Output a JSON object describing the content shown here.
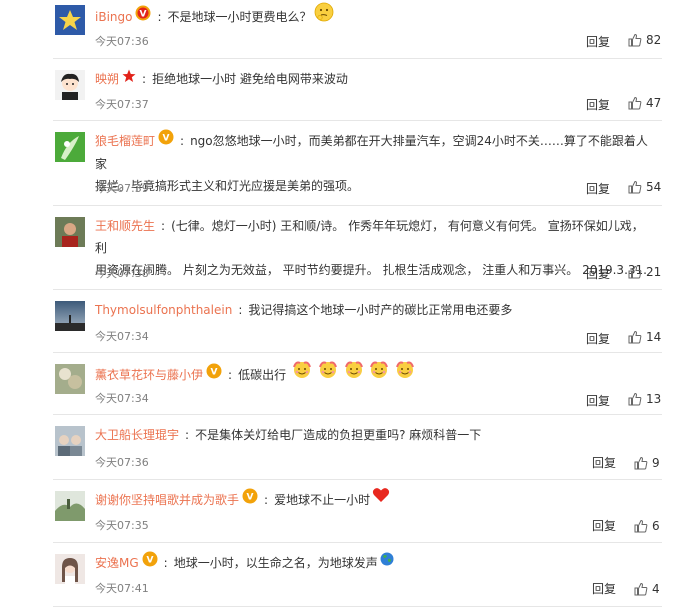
{
  "comments": [
    {
      "user": "iBingo",
      "text": "不是地球一小时更费电么？",
      "time": "今天07:36",
      "reply": "回复",
      "likes": "82"
    },
    {
      "user": "映朔",
      "text": "拒绝地球一小时 避免给电网带来波动",
      "time": "今天07:37",
      "reply": "回复",
      "likes": "47"
    },
    {
      "user": "狼毛榴莲町",
      "text_line1": "ngo忽悠地球一小时，而美弟都在开大排量汽车，空调24小时不关……算了不能跟着人家",
      "text_line2": "摆烂。毕竟搞形式主义和灯光应援是美弟的强项。",
      "time": "今天07:39",
      "reply": "回复",
      "likes": "54"
    },
    {
      "user": "王和顺先生",
      "text_line1": "(七律。熄灯一小时) 王和顺/诗。 作秀年年玩熄灯， 有何意义有何凭。 宣扬环保如儿戏， 利",
      "text_line2": "用资源在闹腾。 片刻之为无效益， 平时节约要提升。 扎根生活成观念， 注重人和万事兴。 2019.3.31.",
      "time": "今天07:38",
      "reply": "回复",
      "likes": "21"
    },
    {
      "user": "Thymolsulfonphthalein",
      "text": "我记得搞这个地球一小时产的碳比正常用电还要多",
      "time": "今天07:34",
      "reply": "回复",
      "likes": "14"
    },
    {
      "user": "薰衣草花环与藤小伊",
      "text": "低碳出行",
      "time": "今天07:34",
      "reply": "回复",
      "likes": "13"
    },
    {
      "user": "大卫船长理琨宇",
      "text": "不是集体关灯给电厂造成的负担更重吗? 麻烦科普一下",
      "time": "今天07:36",
      "reply": "回复",
      "likes": "9"
    },
    {
      "user": "谢谢你坚持唱歌并成为歌手",
      "text": "爱地球不止一小时",
      "time": "今天07:35",
      "reply": "回复",
      "likes": "6"
    },
    {
      "user": "安逸MG",
      "text": "地球一小时，以生命之名，为地球发声",
      "time": "今天07:41",
      "reply": "回复",
      "likes": "4"
    }
  ],
  "colors": {
    "username": "#eb7350",
    "badge": "#f2a20a",
    "time": "#808080",
    "divider": "#e6e6e6"
  },
  "icons": [
    "vip-badge-icon",
    "star-badge-icon",
    "thumbs-up-icon",
    "thinking-face-emoji",
    "smile-emoji",
    "red-heart-emoji",
    "earth-globe-emoji"
  ]
}
